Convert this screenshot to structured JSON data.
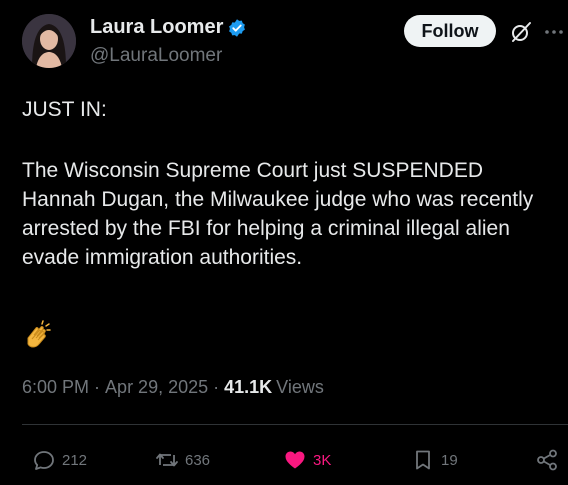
{
  "author": {
    "name": "Laura Loomer",
    "handle": "@LauraLoomer",
    "verified": true,
    "verified_color": "#1d9bf0"
  },
  "header": {
    "follow_label": "Follow",
    "grok_icon": "grok-icon",
    "more_icon": "more-icon"
  },
  "tweet": {
    "heading": "JUST IN:",
    "body": "The Wisconsin Supreme Court just SUSPENDED Hannah Dugan, the Milwaukee judge who was recently arrested by the FBI for helping a criminal illegal alien evade immigration authorities.",
    "emoji": "clapping-hands"
  },
  "meta": {
    "time": "6:00 PM",
    "separator": "·",
    "date": "Apr 29, 2025",
    "views_count": "41.1K",
    "views_label": "Views"
  },
  "actions": {
    "replies": "212",
    "reposts": "636",
    "likes": "3K",
    "bookmarks": "19",
    "like_color": "#f91880",
    "muted_color": "#71767b"
  }
}
